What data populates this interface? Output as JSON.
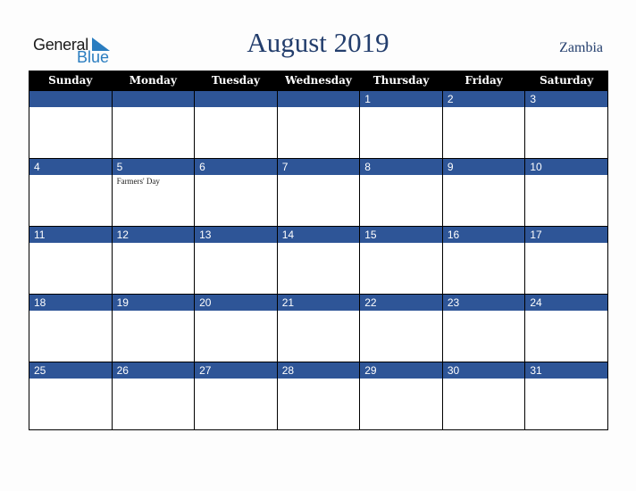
{
  "logo": {
    "word1": "General",
    "word2": "Blue"
  },
  "title": "August 2019",
  "country": "Zambia",
  "colors": {
    "header_bg": "#000000",
    "band": "#2e5597",
    "title": "#233e6d",
    "logo_blue": "#2a7dc0"
  },
  "weekdays": [
    "Sunday",
    "Monday",
    "Tuesday",
    "Wednesday",
    "Thursday",
    "Friday",
    "Saturday"
  ],
  "weeks": [
    [
      {
        "day": ""
      },
      {
        "day": ""
      },
      {
        "day": ""
      },
      {
        "day": ""
      },
      {
        "day": "1"
      },
      {
        "day": "2"
      },
      {
        "day": "3"
      }
    ],
    [
      {
        "day": "4"
      },
      {
        "day": "5",
        "note": "Farmers' Day"
      },
      {
        "day": "6"
      },
      {
        "day": "7"
      },
      {
        "day": "8"
      },
      {
        "day": "9"
      },
      {
        "day": "10"
      }
    ],
    [
      {
        "day": "11"
      },
      {
        "day": "12"
      },
      {
        "day": "13"
      },
      {
        "day": "14"
      },
      {
        "day": "15"
      },
      {
        "day": "16"
      },
      {
        "day": "17"
      }
    ],
    [
      {
        "day": "18"
      },
      {
        "day": "19"
      },
      {
        "day": "20"
      },
      {
        "day": "21"
      },
      {
        "day": "22"
      },
      {
        "day": "23"
      },
      {
        "day": "24"
      }
    ],
    [
      {
        "day": "25"
      },
      {
        "day": "26"
      },
      {
        "day": "27"
      },
      {
        "day": "28"
      },
      {
        "day": "29"
      },
      {
        "day": "30"
      },
      {
        "day": "31"
      }
    ]
  ]
}
